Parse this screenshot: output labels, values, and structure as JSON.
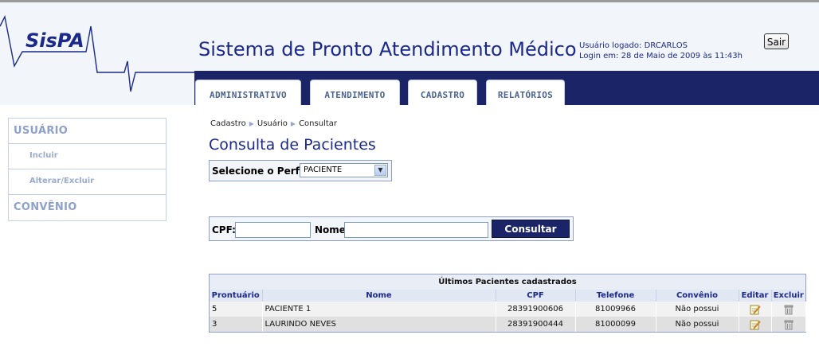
{
  "header": {
    "logo": "SisPA",
    "title": "Sistema de Pronto Atendimento Médico",
    "user_line": "Usuário logado: DRCARLOS",
    "login_line": "Login em: 28 de Maio de 2009 às 11:43h",
    "logout_label": "Sair"
  },
  "tabs": [
    {
      "label": "ADMINISTRATIVO"
    },
    {
      "label": "ATENDIMENTO"
    },
    {
      "label": "CADASTRO"
    },
    {
      "label": "RELATÓRIOS"
    }
  ],
  "sidebar": {
    "items": [
      {
        "label": "USUÁRIO"
      },
      {
        "label": "Incluir"
      },
      {
        "label": "Alterar/Excluir"
      },
      {
        "label": "CONVÊNIO"
      }
    ]
  },
  "breadcrumb": [
    "Cadastro",
    "Usuário",
    "Consultar"
  ],
  "page_title": "Consulta de Pacientes",
  "profile": {
    "label": "Selecione o Perfil",
    "selected": "PACIENTE"
  },
  "search": {
    "cpf_label": "CPF:",
    "cpf_value": "",
    "nome_label": "Nome",
    "nome_value": "",
    "button_label": "Consultar"
  },
  "grid": {
    "caption": "Últimos Pacientes cadastrados",
    "columns": [
      "Prontuário",
      "Nome",
      "CPF",
      "Telefone",
      "Convênio",
      "Editar",
      "Excluir"
    ],
    "rows": [
      {
        "prontuario": "5",
        "nome": "PACIENTE 1",
        "cpf": "28391900606",
        "telefone": "81009966",
        "convenio": "Não possui",
        "edit_icon": "edit-icon",
        "delete_icon": "trash-icon"
      },
      {
        "prontuario": "3",
        "nome": "LAURINDO NEVES",
        "cpf": "28391900444",
        "telefone": "81000099",
        "convenio": "Não possui",
        "edit_icon": "edit-icon",
        "delete_icon": "trash-icon"
      }
    ]
  },
  "colors": {
    "navy": "#1a2466",
    "title_blue": "#1b2a8a",
    "header_bg": "#f2f5fa"
  }
}
